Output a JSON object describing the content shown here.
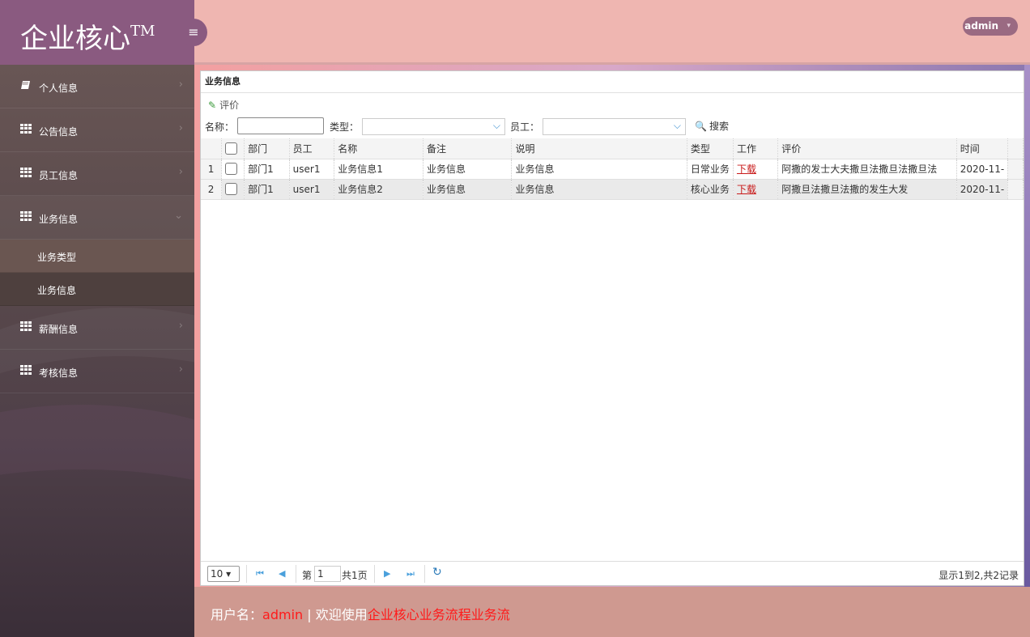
{
  "brand": {
    "title": "企业核心",
    "tm": "TM",
    "toggle_icon": "hamburger-icon"
  },
  "topbar": {
    "user_label": "admin",
    "caret": "▾"
  },
  "sidebar": {
    "items": [
      {
        "label": "个人信息",
        "icon": "book-icon",
        "arrow": "›"
      },
      {
        "label": "公告信息",
        "icon": "grid-icon",
        "arrow": "›"
      },
      {
        "label": "员工信息",
        "icon": "grid-icon",
        "arrow": "›"
      },
      {
        "label": "业务信息",
        "icon": "grid-icon",
        "arrow": "⌄"
      },
      {
        "label": "薪酬信息",
        "icon": "grid-icon",
        "arrow": "›"
      },
      {
        "label": "考核信息",
        "icon": "grid-icon",
        "arrow": "›"
      }
    ],
    "sub_items": [
      {
        "label": "业务类型"
      },
      {
        "label": "业务信息"
      }
    ]
  },
  "panel": {
    "title": "业务信息",
    "toolbar": {
      "eval_label": "评价"
    },
    "search": {
      "name_label": "名称：",
      "name_value": "",
      "type_label": "类型：",
      "type_value": "",
      "staff_label": "员工：",
      "staff_value": "",
      "search_label": "搜索"
    },
    "table": {
      "headers": [
        "部门",
        "员工",
        "名称",
        "备注",
        "说明",
        "类型",
        "工作",
        "评价",
        "时间"
      ],
      "rows": [
        {
          "num": "1",
          "dept": "部门1",
          "staff": "user1",
          "name": "业务信息1",
          "remark": "业务信息",
          "desc": "业务信息",
          "type": "日常业务",
          "work": "下载",
          "eval": "阿撒的发士大夫撒旦法撒旦法撒旦法",
          "time": "2020-11-"
        },
        {
          "num": "2",
          "dept": "部门1",
          "staff": "user1",
          "name": "业务信息2",
          "remark": "业务信息",
          "desc": "业务信息",
          "type": "核心业务",
          "work": "下载",
          "eval": "阿撒旦法撒旦法撒的发生大发",
          "time": "2020-11-"
        }
      ]
    },
    "pager": {
      "page_size": "10",
      "page_prefix": "第",
      "page_value": "1",
      "page_total": "共1页",
      "info": "显示1到2,共2记录"
    }
  },
  "footer": {
    "user_prefix": "用户名：",
    "user_name": "admin",
    "welcome_prefix": " | 欢迎使用",
    "system_name": "企业核心业务流程业务流"
  },
  "colors": {
    "brand_bg": "#8a5a80",
    "topbar_bg": "#efb6b1",
    "footer_bg": "#cf9990",
    "link_red": "#c81a1a"
  }
}
